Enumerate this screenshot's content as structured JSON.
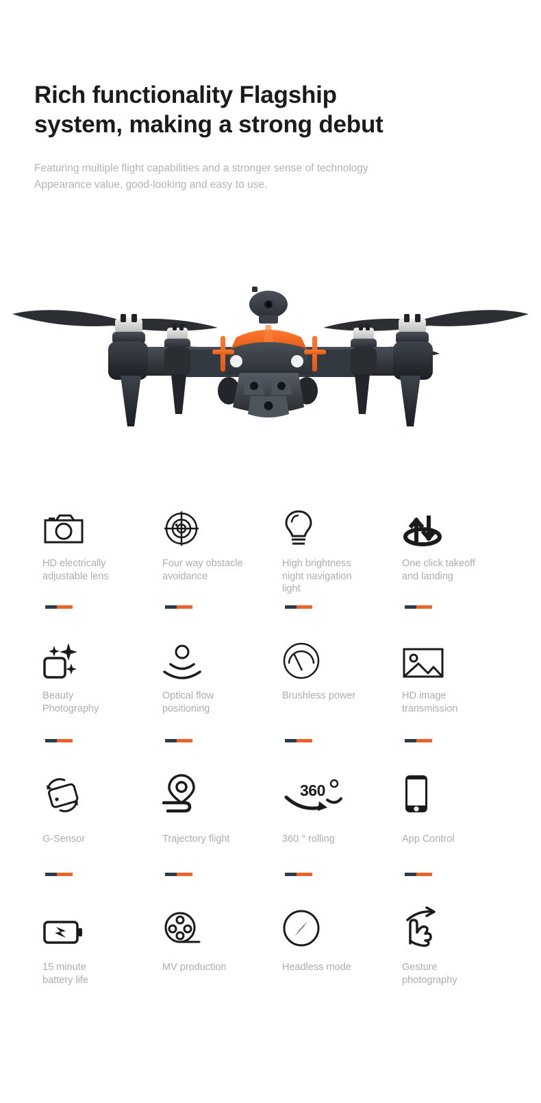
{
  "header": {
    "headline": "Rich functionality  Flagship\nsystem, making a strong debut",
    "subcopy": "Featuring multiple flight capabilities and a stronger sense of technology\nAppearance value, good-looking and easy to use."
  },
  "hero": {
    "alt": "quadcopter drone front view",
    "body_color": "#3a3f45",
    "accent_color": "#f26522",
    "propeller_color": "#2b2f34"
  },
  "colors": {
    "accent_orange": "#e8642a",
    "divider_dark": "#2c3c4c",
    "label_gray": "#adadad",
    "heading_black": "#1b1b1b",
    "subcopy_gray": "#b3b3b3"
  },
  "features": [
    {
      "icon": "camera-icon",
      "label": "HD electrically\nadjustable lens"
    },
    {
      "icon": "radar-target-icon",
      "label": "Four way obstacle\navoidance"
    },
    {
      "icon": "lightbulb-icon",
      "label": "High brightness\nnight navigation\nlight"
    },
    {
      "icon": "takeoff-landing-icon",
      "label": "One click takeoff\nand landing"
    },
    {
      "icon": "sparkle-square-icon",
      "label": "Beauty\nPhotography"
    },
    {
      "icon": "optical-flow-icon",
      "label": "Optical flow\npositioning"
    },
    {
      "icon": "gauge-icon",
      "label": "Brushless power"
    },
    {
      "icon": "image-picture-icon",
      "label": "HD image\ntransmission"
    },
    {
      "icon": "rotate-phone-icon",
      "label": "G-Sensor"
    },
    {
      "icon": "map-pin-path-icon",
      "label": "Trajectory flight"
    },
    {
      "icon": "rolling-360-icon",
      "label": "360 ° rolling"
    },
    {
      "icon": "smartphone-icon",
      "label": "App Control"
    },
    {
      "icon": "battery-bolt-icon",
      "label": "15 minute\nbattery life"
    },
    {
      "icon": "film-reel-icon",
      "label": "MV production"
    },
    {
      "icon": "compass-icon",
      "label": "Headless mode"
    },
    {
      "icon": "hand-gesture-icon",
      "label": "Gesture\nphotography"
    }
  ],
  "icon_text": {
    "rolling_360": "360"
  }
}
